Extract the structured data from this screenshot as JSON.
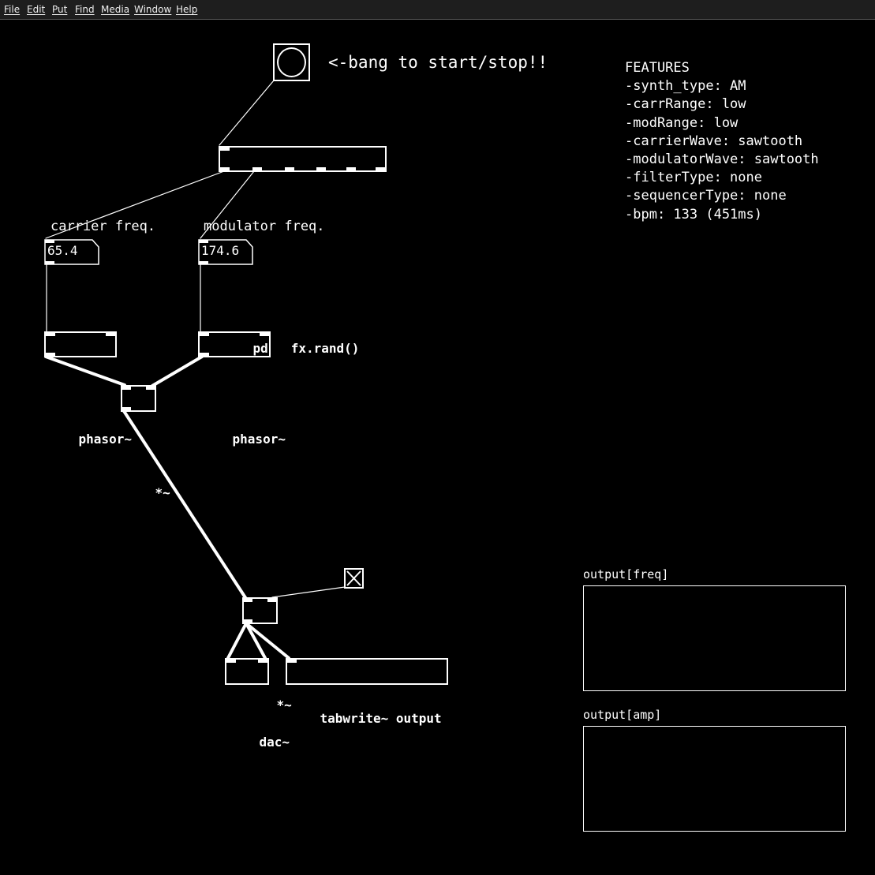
{
  "menu": [
    "File",
    "Edit",
    "Put",
    "Find",
    "Media",
    "Window",
    "Help"
  ],
  "bang_comment": "<-bang to start/stop!!",
  "subpatch": {
    "kind": "pd",
    "name": "fx.rand()"
  },
  "carrier": {
    "label": "carrier freq.",
    "value": "65.4",
    "osc": "phasor~"
  },
  "modulator": {
    "label": "modulator freq.",
    "value": "174.6",
    "osc": "phasor~"
  },
  "mult1": "*~",
  "mult2": "*~",
  "toggle_state": "on",
  "dac": "dac~",
  "tabwrite": "tabwrite~ output",
  "features": {
    "title": "FEATURES",
    "lines": [
      "-synth_type: AM",
      "-carrRange: low",
      "-modRange: low",
      "-carrierWave: sawtooth",
      "-modulatorWave: sawtooth",
      "-filterType: none",
      "-sequencerType: none",
      "-bpm: 133 (451ms)"
    ]
  },
  "arrays": {
    "freq_label": "output[freq]",
    "amp_label": "output[amp]"
  }
}
